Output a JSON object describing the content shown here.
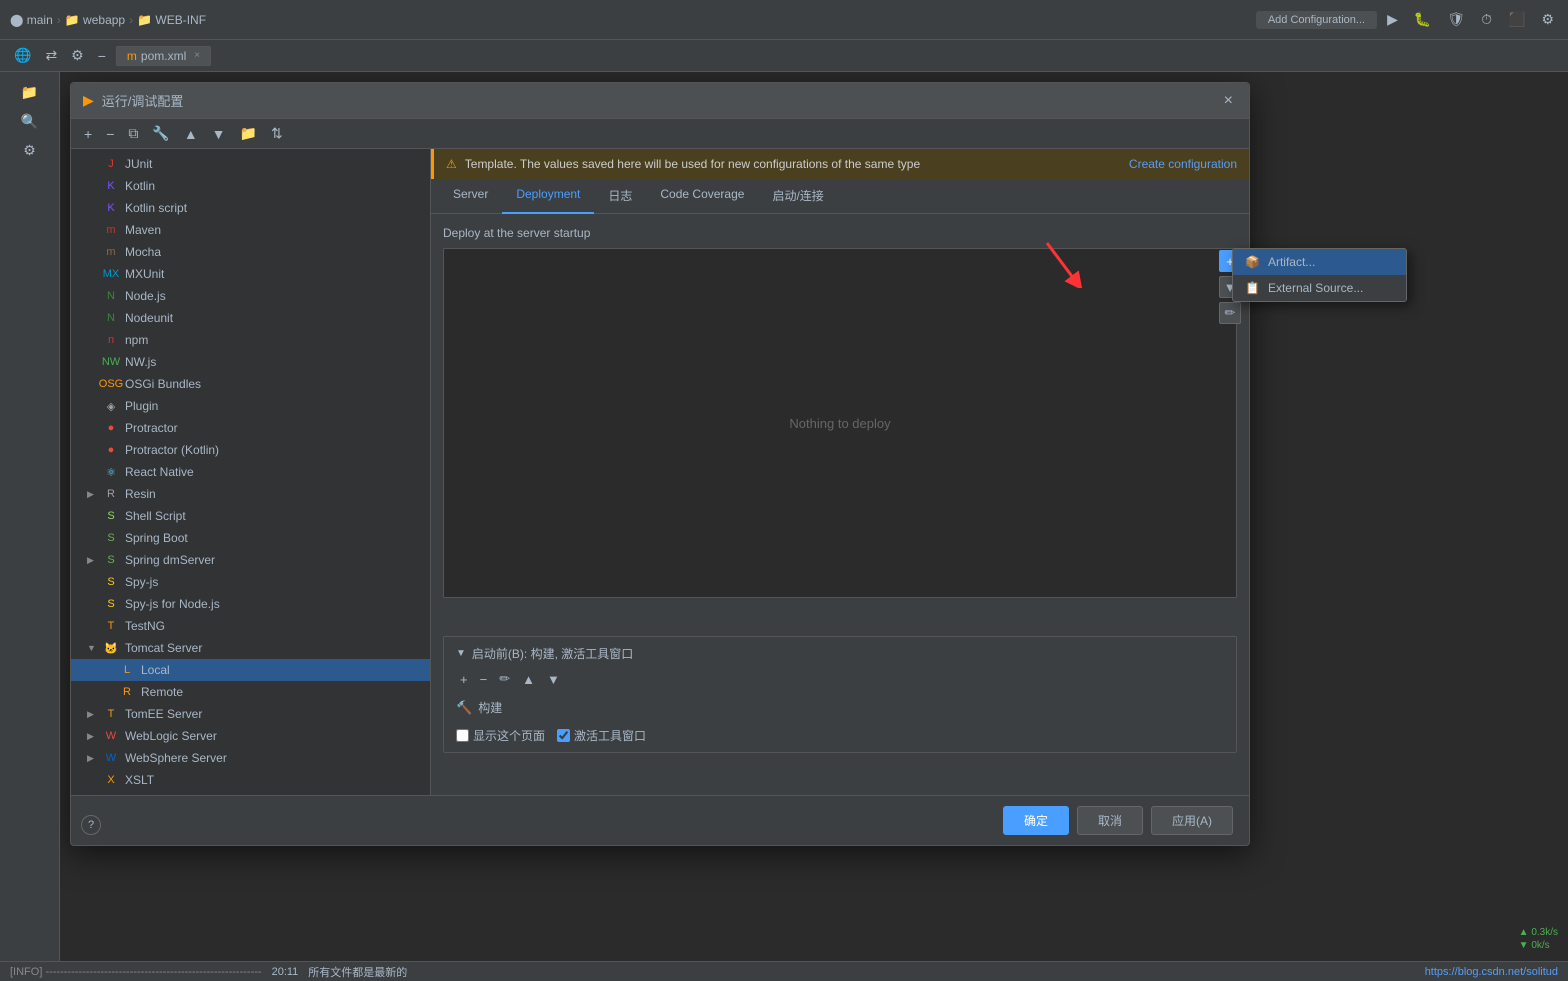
{
  "topbar": {
    "breadcrumb": [
      "main",
      "webapp",
      "WEB-INF"
    ],
    "add_config_label": "Add Configuration...",
    "file_tab": "pom.xml"
  },
  "dialog": {
    "title": "运行/调试配置",
    "close_btn": "×",
    "warning_text": "Template. The values saved here will be used for new configurations of the same type",
    "create_config_link": "Create configuration",
    "tabs": [
      "Server",
      "Deployment",
      "日志",
      "Code Coverage",
      "启动/连接"
    ],
    "active_tab": "Deployment",
    "deploy_header": "Deploy at the server startup",
    "nothing_to_deploy": "Nothing to deploy",
    "dropdown": {
      "items": [
        "Artifact...",
        "External Source..."
      ]
    },
    "before_launch_title": "启动前(B): 构建, 激活工具窗口",
    "build_item": "构建",
    "checkbox1": "显示这个页面",
    "checkbox2": "激活工具窗口",
    "footer": {
      "ok": "确定",
      "cancel": "取消",
      "apply": "应用(A)"
    }
  },
  "list_items": [
    {
      "id": "junit",
      "label": "JUnit",
      "icon": "J",
      "color": "#e8342a",
      "expandable": false,
      "indent": 0
    },
    {
      "id": "kotlin",
      "label": "Kotlin",
      "icon": "K",
      "color": "#7f52ff",
      "expandable": false,
      "indent": 0
    },
    {
      "id": "kotlin-script",
      "label": "Kotlin script",
      "icon": "K",
      "color": "#7f52ff",
      "expandable": false,
      "indent": 0
    },
    {
      "id": "maven",
      "label": "Maven",
      "icon": "m",
      "color": "#c0392b",
      "expandable": false,
      "indent": 0
    },
    {
      "id": "mocha",
      "label": "Mocha",
      "icon": "m",
      "color": "#8d6748",
      "expandable": false,
      "indent": 0
    },
    {
      "id": "mxunit",
      "label": "MXUnit",
      "icon": "MX",
      "color": "#0099cc",
      "expandable": false,
      "indent": 0
    },
    {
      "id": "nodejs",
      "label": "Node.js",
      "icon": "N",
      "color": "#3c873a",
      "expandable": false,
      "indent": 0
    },
    {
      "id": "nodeunit",
      "label": "Nodeunit",
      "icon": "N",
      "color": "#3c873a",
      "expandable": false,
      "indent": 0
    },
    {
      "id": "npm",
      "label": "npm",
      "icon": "n",
      "color": "#cc3534",
      "expandable": false,
      "indent": 0
    },
    {
      "id": "nw",
      "label": "NW.js",
      "icon": "NW",
      "color": "#4caf50",
      "expandable": false,
      "indent": 0
    },
    {
      "id": "osgi",
      "label": "OSGi Bundles",
      "icon": "OSG",
      "color": "#ff9800",
      "expandable": false,
      "indent": 0
    },
    {
      "id": "plugin",
      "label": "Plugin",
      "icon": "◈",
      "color": "#a0a0a0",
      "expandable": false,
      "indent": 0
    },
    {
      "id": "protractor",
      "label": "Protractor",
      "icon": "●",
      "color": "#e74c3c",
      "expandable": false,
      "indent": 0
    },
    {
      "id": "protractor-kotlin",
      "label": "Protractor (Kotlin)",
      "icon": "●",
      "color": "#e74c3c",
      "expandable": false,
      "indent": 0
    },
    {
      "id": "react-native",
      "label": "React Native",
      "icon": "⚛",
      "color": "#61dafb",
      "expandable": false,
      "indent": 0
    },
    {
      "id": "resin",
      "label": "Resin",
      "icon": "R",
      "color": "#a0a0a0",
      "expandable": true,
      "indent": 0
    },
    {
      "id": "shell-script",
      "label": "Shell Script",
      "icon": "S",
      "color": "#89e051",
      "expandable": false,
      "indent": 0
    },
    {
      "id": "spring-boot",
      "label": "Spring Boot",
      "icon": "S",
      "color": "#6db33f",
      "expandable": false,
      "indent": 0
    },
    {
      "id": "spring-dm",
      "label": "Spring dmServer",
      "icon": "S",
      "color": "#6db33f",
      "expandable": true,
      "indent": 0
    },
    {
      "id": "spy-js",
      "label": "Spy-js",
      "icon": "S",
      "color": "#ffcc00",
      "expandable": false,
      "indent": 0
    },
    {
      "id": "spy-js-node",
      "label": "Spy-js for Node.js",
      "icon": "S",
      "color": "#ffcc00",
      "expandable": false,
      "indent": 0
    },
    {
      "id": "testng",
      "label": "TestNG",
      "icon": "T",
      "color": "#ff9800",
      "expandable": false,
      "indent": 0
    },
    {
      "id": "tomcat",
      "label": "Tomcat Server",
      "icon": "🐱",
      "color": "#f39c12",
      "expandable": true,
      "expanded": true,
      "indent": 0
    },
    {
      "id": "tomcat-local",
      "label": "Local",
      "icon": "L",
      "color": "#f39c12",
      "expandable": false,
      "indent": 1,
      "selected": true
    },
    {
      "id": "tomcat-remote",
      "label": "Remote",
      "icon": "R",
      "color": "#f39c12",
      "expandable": false,
      "indent": 1
    },
    {
      "id": "tomee",
      "label": "TomEE Server",
      "icon": "T",
      "color": "#f39c12",
      "expandable": true,
      "indent": 0
    },
    {
      "id": "weblogic",
      "label": "WebLogic Server",
      "icon": "W",
      "color": "#e74c3c",
      "expandable": true,
      "indent": 0
    },
    {
      "id": "websphere",
      "label": "WebSphere Server",
      "icon": "W",
      "color": "#0066cc",
      "expandable": true,
      "indent": 0
    },
    {
      "id": "xslt",
      "label": "XSLT",
      "icon": "X",
      "color": "#ff9800",
      "expandable": false,
      "indent": 0
    }
  ],
  "status_bar": {
    "info_text": "[INFO] -----------------------------------------------------------",
    "time": "20:11",
    "status": "所有文件都是最新的",
    "url": "https://blog.csdn.net/solitud",
    "traffic_up": "▲ 0.3k/s",
    "traffic_down": "▼ 0k/s"
  }
}
